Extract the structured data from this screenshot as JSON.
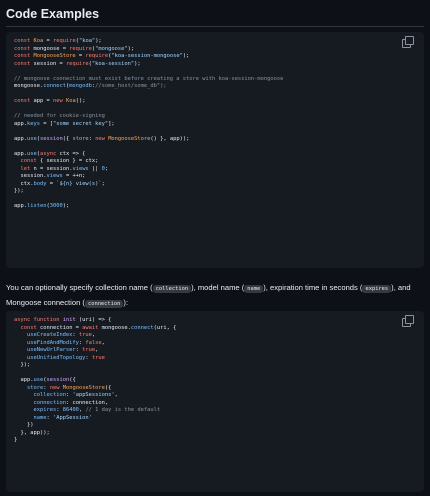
{
  "section": {
    "title": "Code Examples"
  },
  "code_block_1": {
    "lines": [
      "const Koa = require(\"koa\");",
      "const mongoose = require(\"mongoose\");",
      "const MongooseStore = require(\"koa-session-mongoose\");",
      "const session = require(\"koa-session\");",
      "",
      "// mongoose connection must exist before creating a store with koa-session-mongoose",
      "mongoose.connect(\"mongodb://some_host/some_db\");",
      "",
      "const app = new Koa();",
      "",
      "// needed for cookie-signing",
      "app.keys = [\"some secret key\"];",
      "",
      "app.use(session({ store: new MongooseStore() }, app));",
      "",
      "app.use(async ctx => {",
      "  const { session } = ctx;",
      "  let n = session.views || 0;",
      "  session.views = ++n;",
      "  ctx.body = `${n} view(s)`;",
      "});",
      "",
      "app.listen(3000);"
    ]
  },
  "paragraph": {
    "p1": "You can optionally specify collection name (",
    "code1": "collection",
    "p2": "), model name (",
    "code2": "name",
    "p3": "), expiration time in seconds (",
    "code3": "expires",
    "p4": "), and Mongoose connection (",
    "code4": "connection",
    "p5": "):"
  },
  "code_block_2": {
    "lines": [
      "async function init (uri) => {",
      "  const connection = await mongoose.connect(uri, {",
      "    useCreateIndex: true,",
      "    useFindAndModify: false,",
      "    useNewUrlParser: true,",
      "    useUnifiedTopology: true",
      "  });",
      "",
      "  app.use(session({",
      "    store: new MongooseStore({",
      "      collection: 'appSessions',",
      "      connection: connection,",
      "      expires: 86400, // 1 day is the default",
      "      name: 'AppSession'",
      "    })",
      "  }, app));",
      "}"
    ]
  },
  "icons": {
    "copy": "copy-icon"
  },
  "colors": {
    "background": "#0d1117",
    "code_background": "#161b22",
    "keyword": "#ff7b72",
    "string": "#a5d6ff",
    "comment": "#8b949e",
    "property": "#79c0ff",
    "function": "#d2a8ff",
    "class": "#ffa657"
  }
}
